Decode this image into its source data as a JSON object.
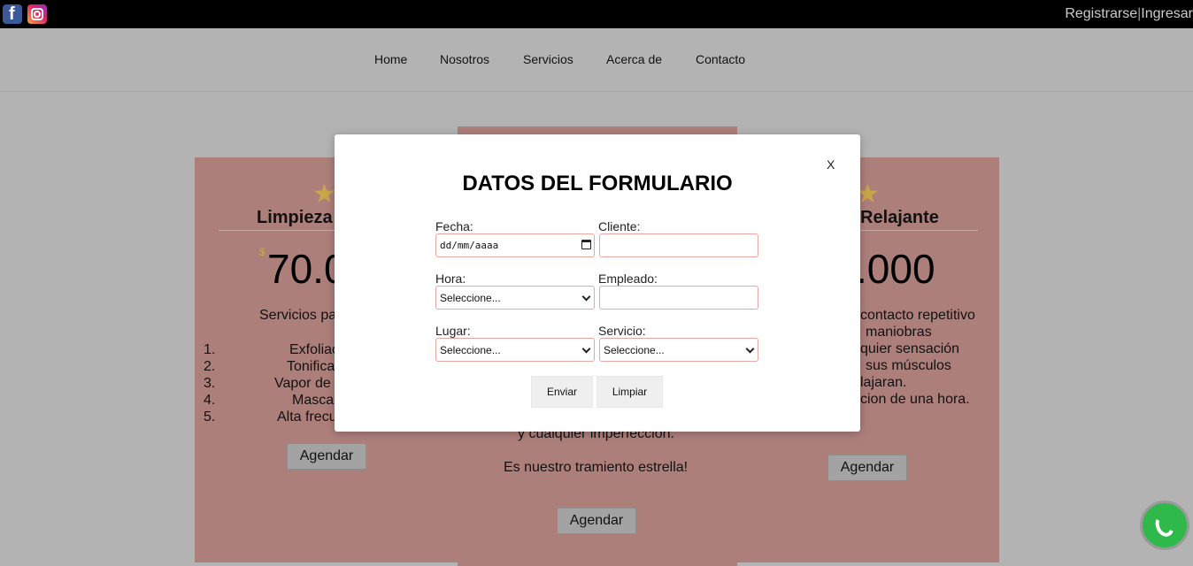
{
  "topbar": {
    "facebook_icon": "facebook-icon",
    "instagram_icon": "instagram-icon",
    "register_label": "Registrarse",
    "separator": "|",
    "login_label": "Ingresar"
  },
  "nav": {
    "items": [
      "Home",
      "Nosotros",
      "Servicios",
      "Acerca de",
      "Contacto"
    ]
  },
  "cards": {
    "left": {
      "title": "Limpieza",
      "currency": "$",
      "price": "70.0",
      "intro": "Servicios pa",
      "list": [
        {
          "num": "1.",
          "text": "Exfoliac"
        },
        {
          "num": "2.",
          "text": "Tonifica"
        },
        {
          "num": "3.",
          "text": "Vapor de"
        },
        {
          "num": "4.",
          "text": "Masca"
        },
        {
          "num": "5.",
          "text": "Alta frecu"
        }
      ],
      "button": "Agendar"
    },
    "middle": {
      "lines": [
        "y cualquier imperfeccion.",
        "Es nuestro tramiento estrella!"
      ],
      "button": "Agendar"
    },
    "right": {
      "title": "Relajante",
      "price": ".000",
      "lines": [
        "contacto repetitivo",
        "maniobras",
        "quier sensación",
        "sus músculos",
        "lajaran.",
        "cion de una hora."
      ],
      "button": "Agendar"
    }
  },
  "modal": {
    "close": "X",
    "title": "DATOS DEL FORMULARIO",
    "fields": {
      "fecha": {
        "label": "Fecha:",
        "value": "dd/mm/aaaa"
      },
      "cliente": {
        "label": "Cliente:",
        "value": ""
      },
      "hora": {
        "label": "Hora:",
        "value": "Seleccione..."
      },
      "empleado": {
        "label": "Empleado:",
        "value": ""
      },
      "lugar": {
        "label": "Lugar:",
        "value": "Seleccione..."
      },
      "servicio": {
        "label": "Servicio:",
        "value": "Seleccione..."
      }
    },
    "submit": "Enviar",
    "reset": "Limpiar"
  },
  "colors": {
    "card": "#ad7f7b",
    "overlay_bg": "#b3b3b3",
    "input_border": "#e8a7a0",
    "whatsapp": "#2fb94a"
  },
  "whatsapp_icon": "whatsapp-icon"
}
